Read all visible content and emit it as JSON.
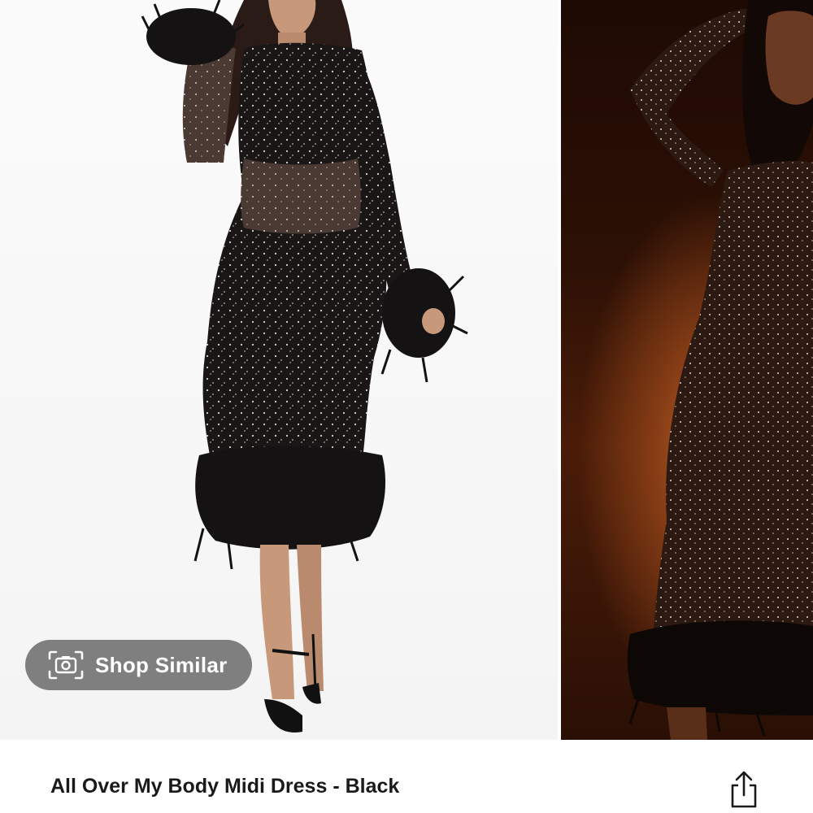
{
  "product": {
    "title": "All Over My Body Midi Dress - Black"
  },
  "shop_similar": {
    "label": "Shop Similar",
    "icon": "camera-icon"
  },
  "share": {
    "icon": "share-icon"
  },
  "gallery": {
    "images": [
      "dress-front-white-background",
      "dress-model-warm-background"
    ]
  },
  "colors": {
    "pill_background": "#6e6e6e",
    "pill_text": "#ffffff",
    "title_text": "#1a1a1a"
  }
}
